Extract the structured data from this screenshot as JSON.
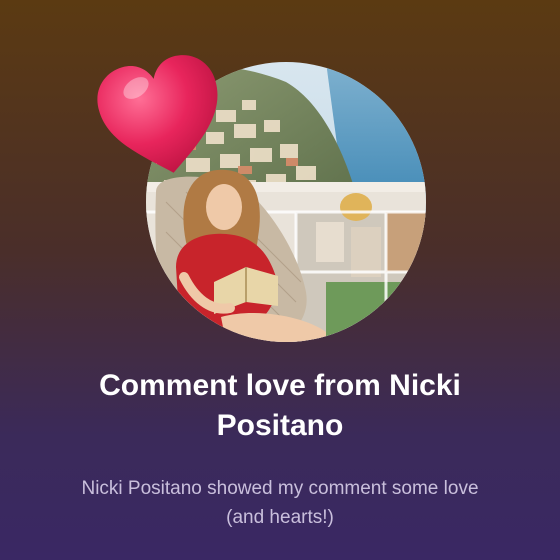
{
  "notification": {
    "title": "Comment love from Nicki Positano",
    "message": "Nicki Positano showed my comment some love (and hearts!)",
    "avatar_icon": "profile-photo",
    "badge_icon": "heart-icon",
    "colors": {
      "heart": "#e8255c",
      "title_text": "#ffffff",
      "subtitle_text": "#c9bfdc",
      "background_top": "#5b3a12",
      "background_bottom": "#3a2864"
    }
  }
}
